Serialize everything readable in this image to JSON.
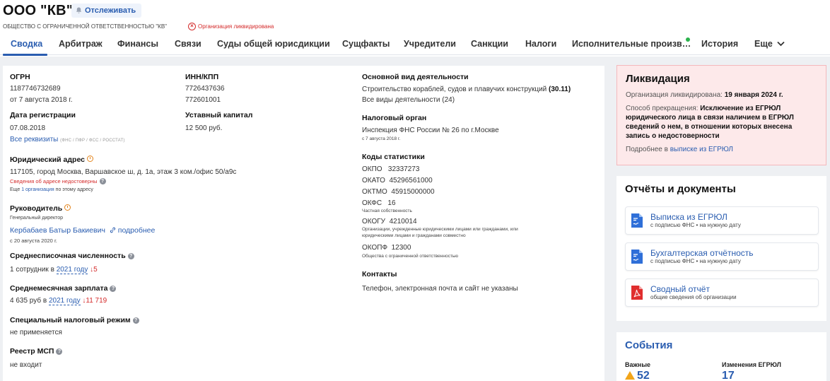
{
  "header": {
    "title": "ООО \"КВ\"",
    "follow_label": "Отслеживать",
    "subtitle": "ОБЩЕСТВО С ОГРАНИЧЕННОЙ ОТВЕТСТВЕННОСТЬЮ \"КВ\"",
    "status": "Организация ликвидирована"
  },
  "tabs": [
    {
      "label": "Сводка",
      "active": true
    },
    {
      "label": "Арбитраж"
    },
    {
      "label": "Финансы"
    },
    {
      "label": "Связи"
    },
    {
      "label": "Суды общей юрисдикции"
    },
    {
      "label": "Сущфакты"
    },
    {
      "label": "Учредители"
    },
    {
      "label": "Санкции"
    },
    {
      "label": "Налоги"
    },
    {
      "label": "Исполнительные произв…"
    },
    {
      "label": "История"
    },
    {
      "label": "Еще"
    }
  ],
  "main": {
    "ogrn": {
      "label": "ОГРН",
      "value": "1187746732689",
      "date": "от 7 августа 2018 г."
    },
    "inn": {
      "label": "ИНН/КПП",
      "inn": "7726437636",
      "kpp": "772601001"
    },
    "reg_date": {
      "label": "Дата регистрации",
      "value": "07.08.2018"
    },
    "capital": {
      "label": "Уставный капитал",
      "value": "12 500 руб."
    },
    "all_requisites": {
      "link": "Все реквизиты",
      "note": "(ФНС / ПФР / ФСС / РОССТАТ)"
    },
    "address": {
      "label": "Юридический адрес",
      "value": "117105, город Москва, Варшавское ш, д. 1а, этаж 3 ком./офис 50/а9с",
      "warning": "Сведения об адресе недостоверны",
      "more_prefix": "Еще",
      "more_link": "1 организация",
      "more_suffix": "по этому адресу"
    },
    "director": {
      "label": "Руководитель",
      "position": "Генеральный директор",
      "name": "Кербабаев Батыр Бакиевич",
      "more": "подробнее",
      "since": "с 20 августа 2020 г."
    },
    "employees": {
      "label": "Среднесписочная численность",
      "prefix": "1 сотрудник в",
      "year": "2021 году",
      "delta": "↓5"
    },
    "salary": {
      "label": "Среднемесячная зарплата",
      "prefix": "4 635 руб в",
      "year": "2021 году",
      "delta": "↓11 719"
    },
    "tax_regime": {
      "label": "Специальный налоговый режим",
      "value": "не применяется"
    },
    "msp": {
      "label": "Реестр МСП",
      "value": "не входит"
    },
    "activity": {
      "label": "Основной вид деятельности",
      "value": "Строительство кораблей, судов и плавучих конструкций",
      "code": "(30.11)",
      "all_link": "Все виды деятельности (24)"
    },
    "tax_office": {
      "label": "Налоговый орган",
      "value": "Инспекция ФНС России № 26 по г.Москве",
      "date": "с 7 августа 2018 г."
    },
    "stat_codes": {
      "label": "Коды статистики",
      "okpo": "ОКПО   32337273",
      "okato": "ОКАТО  45296561000",
      "oktmo": "ОКТМО  45915000000",
      "okfs": "ОКФС   16",
      "okfs_desc": "Частная собственность",
      "okogu": "ОКОГУ  4210014",
      "okogu_desc1": "Организации, учрежденные юридическими лицами или гражданами, или",
      "okogu_desc2": "юридическими лицами и гражданами совместно",
      "okopf": "ОКОПФ  12300",
      "okopf_desc": "Общества с ограниченной ответственностью"
    },
    "contacts": {
      "label": "Контакты",
      "value": "Телефон, электронная почта и сайт не указаны"
    }
  },
  "liquidation": {
    "title": "Ликвидация",
    "line1_prefix": "Организация ликвидирована:",
    "line1_date": "19 января 2024 г.",
    "reason_prefix": "Способ прекращения:",
    "reason": "Исключение из ЕГРЮЛ юридического лица в связи наличием в ЕГРЮЛ сведений о нем, в отношении которых внесена запись о недостоверности",
    "more_prefix": "Подробнее в",
    "more_link": "выписке из ЕГРЮЛ"
  },
  "docs": {
    "title": "Отчёты и документы",
    "items": [
      {
        "title": "Выписка из ЕГРЮЛ",
        "sub": "с подписью ФНС • на нужную дату",
        "icon": "blue-doc-icon"
      },
      {
        "title": "Бухгалтерская отчётность",
        "sub": "с подписью ФНС • на нужную дату",
        "icon": "blue-doc-icon"
      },
      {
        "title": "Сводный отчёт",
        "sub": "общие сведения об организации",
        "icon": "pdf-icon"
      }
    ]
  },
  "events": {
    "title": "События",
    "important_label": "Важные",
    "important_value": "52",
    "changes_label": "Изменения ЕГРЮЛ",
    "changes_value": "17"
  },
  "colors": {
    "accent": "#2a5db0",
    "danger": "#d42b2b",
    "liq_bg": "#fde9ea",
    "warn": "#f2a51a"
  }
}
